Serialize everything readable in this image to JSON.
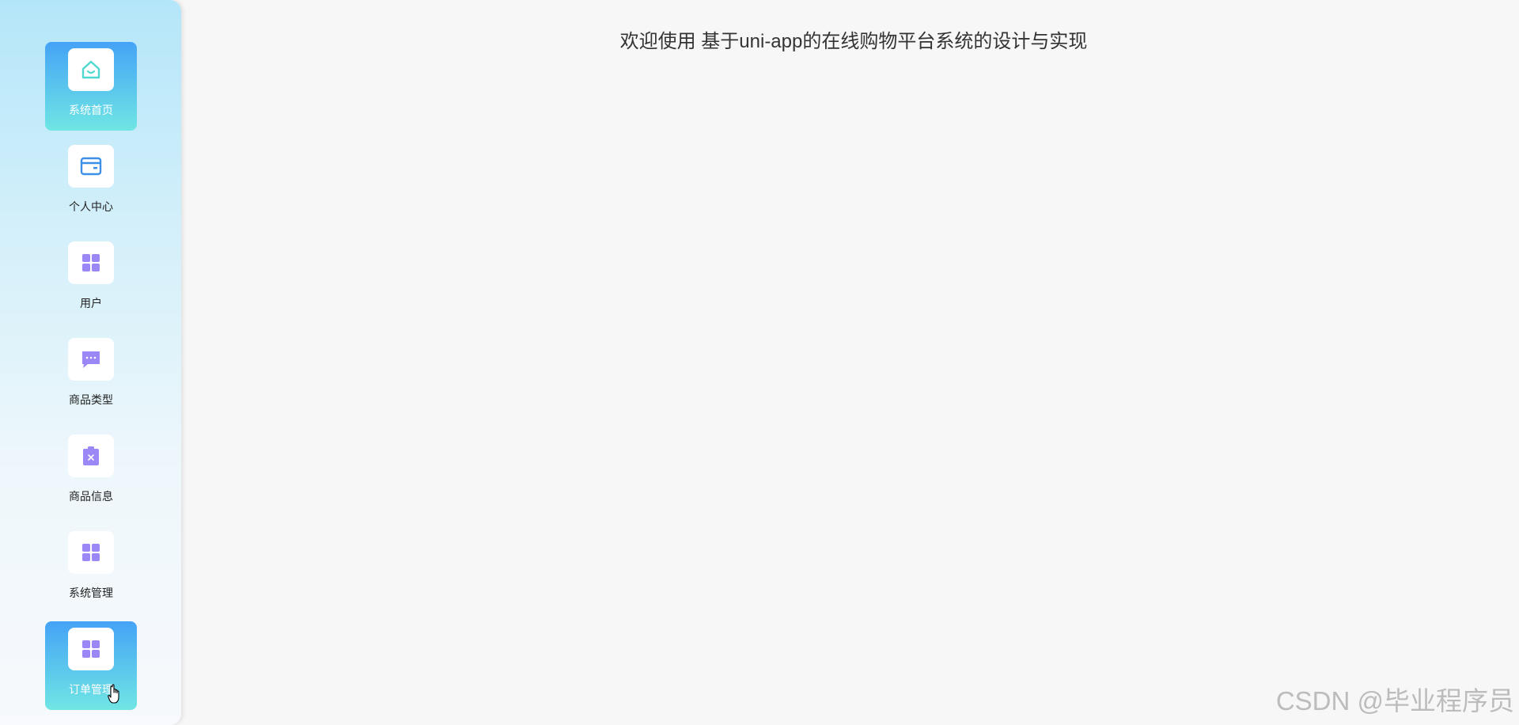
{
  "sidebar": {
    "items": [
      {
        "label": "系统首页",
        "icon": "home-icon",
        "active": true
      },
      {
        "label": "个人中心",
        "icon": "wallet-card-icon",
        "active": false
      },
      {
        "label": "用户",
        "icon": "grid-icon",
        "active": false
      },
      {
        "label": "商品类型",
        "icon": "chat-bubble-icon",
        "active": false
      },
      {
        "label": "商品信息",
        "icon": "clipboard-icon",
        "active": false
      },
      {
        "label": "系统管理",
        "icon": "grid-icon",
        "active": false
      },
      {
        "label": "订单管理",
        "icon": "grid-icon",
        "active": true
      }
    ]
  },
  "main": {
    "welcome_text": "欢迎使用 基于uni-app的在线购物平台系统的设计与实现"
  },
  "watermark": "CSDN @毕业程序员",
  "colors": {
    "accent_blue": "#45a3f6",
    "accent_teal": "#6fe6e4",
    "icon_purple": "#9b87f5",
    "icon_blue": "#3b8fe6",
    "home_icon_teal": "#4fd8d0"
  }
}
